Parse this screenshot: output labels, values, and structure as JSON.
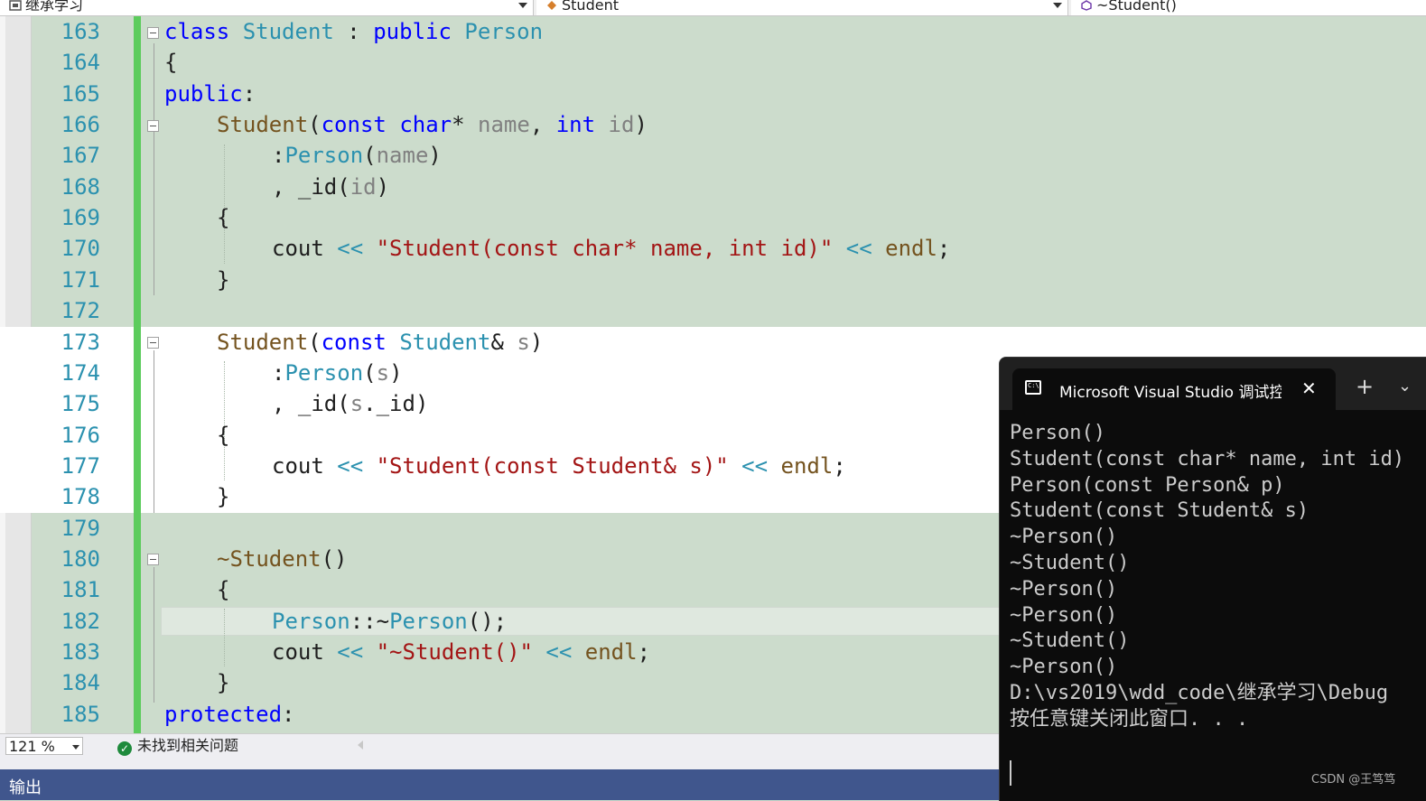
{
  "navbar": {
    "project": "继承学习",
    "scope": "Student",
    "member": "~Student()"
  },
  "editor": {
    "lines": [
      {
        "num": "163"
      },
      {
        "num": "164"
      },
      {
        "num": "165"
      },
      {
        "num": "166"
      },
      {
        "num": "167"
      },
      {
        "num": "168"
      },
      {
        "num": "169"
      },
      {
        "num": "170"
      },
      {
        "num": "171"
      },
      {
        "num": "172"
      },
      {
        "num": "173"
      },
      {
        "num": "174"
      },
      {
        "num": "175"
      },
      {
        "num": "176"
      },
      {
        "num": "177"
      },
      {
        "num": "178"
      },
      {
        "num": "179"
      },
      {
        "num": "180"
      },
      {
        "num": "181"
      },
      {
        "num": "182"
      },
      {
        "num": "183"
      },
      {
        "num": "184"
      },
      {
        "num": "185"
      }
    ],
    "code": {
      "l163": {
        "kw1": "class",
        "t1": "Student",
        "p1": " : ",
        "kw2": "public",
        "t2": "Person"
      },
      "l164": {
        "brace": "{"
      },
      "l165": {
        "kw": "public",
        "colon": ":"
      },
      "l166": {
        "fn": "Student",
        "open": "(",
        "kw1": "const",
        "kw2": "char",
        "star": "*",
        "p1": "name",
        "comma": ", ",
        "kw3": "int",
        "p2": "id",
        "close": ")"
      },
      "l167": {
        "colon": ":",
        "ty": "Person",
        "open": "(",
        "p": "name",
        "close": ")"
      },
      "l168": {
        "pre": ", _id(",
        "p": "id",
        "close": ")"
      },
      "l169": {
        "brace": "{"
      },
      "l170": {
        "cout": "cout",
        "op1": " << ",
        "str": "\"Student(const char* name, int id)\"",
        "op2": " << ",
        "endl": "endl",
        "semi": ";"
      },
      "l171": {
        "brace": "}"
      },
      "l173": {
        "fn": "Student",
        "open": "(",
        "kw": "const",
        "ty": "Student",
        "amp": "& ",
        "p": "s",
        "close": ")"
      },
      "l174": {
        "colon": ":",
        "ty": "Person",
        "open": "(",
        "p": "s",
        "close": ")"
      },
      "l175": {
        "pre": ", _id(",
        "p": "s",
        "post": "._id)"
      },
      "l176": {
        "brace": "{"
      },
      "l177": {
        "cout": "cout",
        "op1": " << ",
        "str": "\"Student(const Student& s)\"",
        "op2": " << ",
        "endl": "endl",
        "semi": ";"
      },
      "l178": {
        "brace": "}"
      },
      "l180": {
        "fn": "~Student",
        "parens": "()"
      },
      "l181": {
        "brace": "{"
      },
      "l182": {
        "ty1": "Person",
        "sep": "::~",
        "ty2": "Person",
        "end": "();"
      },
      "l183": {
        "cout": "cout",
        "op1": " << ",
        "str": "\"~Student()\"",
        "op2": " << ",
        "endl": "endl",
        "semi": ";"
      },
      "l184": {
        "brace": "}"
      },
      "l185": {
        "kw": "protected",
        "colon": ":"
      }
    }
  },
  "statusbar": {
    "zoom": "121 %",
    "issues": "未找到相关问题"
  },
  "output": {
    "label": "输出"
  },
  "console": {
    "tab_title": "Microsoft Visual Studio 调试控制台",
    "close": "✕",
    "plus": "+",
    "dropdown": "⌄",
    "lines": [
      "Person()",
      "Student(const char* name, int id)",
      "Person(const Person& p)",
      "Student(const Student& s)",
      "~Person()",
      "~Student()",
      "~Person()",
      "~Person()",
      "~Student()",
      "~Person()",
      "",
      "D:\\vs2019\\wdd_code\\继承学习\\Debug",
      "按任意键关闭此窗口. . ."
    ]
  },
  "watermark": "CSDN @王笃笃",
  "colors": {
    "editor_bg": "#ccdccc",
    "keyword": "#0000ff",
    "type": "#2b91af",
    "function": "#74531f",
    "parameter": "#808080",
    "string": "#a31515",
    "change_bar": "#5ccc5c",
    "output_bar": "#40568d",
    "console_bg": "#0c0c0c"
  }
}
